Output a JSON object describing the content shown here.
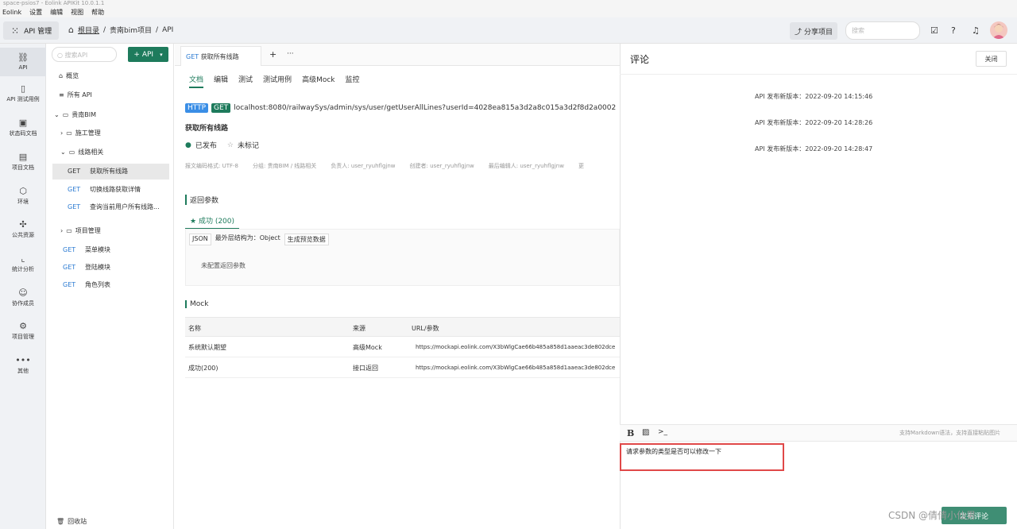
{
  "window": {
    "title": "space-psios7 - Eolink APIKit 10.0.1.1"
  },
  "menu": [
    "Eolink",
    "设置",
    "编辑",
    "视图",
    "帮助"
  ],
  "topbar": {
    "apps_label": "API 管理",
    "breadcrumb": {
      "root": "根目录",
      "project": "贵南bim项目",
      "section": "API"
    },
    "share_label": "分享项目",
    "search_placeholder": "搜索"
  },
  "leftnav": [
    {
      "label": "API",
      "icon": "link-icon"
    },
    {
      "label": "API 测试用例",
      "icon": "clipboard-icon"
    },
    {
      "label": "状态码文档",
      "icon": "code-icon"
    },
    {
      "label": "项目文档",
      "icon": "document-icon"
    },
    {
      "label": "环境",
      "icon": "cube-icon"
    },
    {
      "label": "公共资源",
      "icon": "puzzle-icon"
    },
    {
      "label": "统计分析",
      "icon": "chart-icon"
    },
    {
      "label": "协作成员",
      "icon": "users-icon"
    },
    {
      "label": "项目管理",
      "icon": "settings-icon"
    },
    {
      "label": "其他",
      "icon": "more-icon"
    }
  ],
  "tree": {
    "search_placeholder": "搜索API",
    "add_label": "+ API",
    "overview": "概览",
    "all_api": "所有 API",
    "group": "贵南BIM",
    "folder1": "施工管理",
    "folder2": "线路相关",
    "items": [
      {
        "method": "GET",
        "name": "获取所有线路"
      },
      {
        "method": "GET",
        "name": "切换线路获取详情"
      },
      {
        "method": "GET",
        "name": "查询当前用户所有线路..."
      }
    ],
    "folder3": "项目管理",
    "root_items": [
      {
        "method": "GET",
        "name": "菜单模块"
      },
      {
        "method": "GET",
        "name": "登陆模块"
      },
      {
        "method": "GET",
        "name": "角色列表"
      }
    ],
    "recycle": "回收站"
  },
  "doc_tab": {
    "method": "GET",
    "name": "获取所有线路",
    "add": "+",
    "more": "···"
  },
  "subtabs": [
    "文档",
    "编辑",
    "测试",
    "测试用例",
    "高级Mock",
    "监控"
  ],
  "api": {
    "protocol": "HTTP",
    "method": "GET",
    "url": "localhost:8080/railwaySys/admin/sys/user/getUserAllLines?userId=4028ea815a3d2a8c015a3d2f8d2a0002",
    "name": "获取所有线路",
    "status": "已发布",
    "mark": "未标记",
    "meta": [
      "报文编码格式: UTF-8",
      "分组: 贵南BIM / 线路相关",
      "负责人: user_ryuhflgjnw",
      "创建者: user_ryuhflgjnw",
      "最后编辑人: user_ryuhflgjnw",
      "更"
    ]
  },
  "response": {
    "section": "返回参数",
    "tab": "成功 (200)",
    "format": "JSON",
    "outer": "最外层结构为：Object",
    "gen": "生成预览数据",
    "empty": "未配置返回参数"
  },
  "mock": {
    "section": "Mock",
    "headers": [
      "名称",
      "来源",
      "URL/参数"
    ],
    "rows": [
      [
        "系统默认期望",
        "高级Mock",
        "https://mockapi.eolink.com/X3bWlgCae66b485a858d1aaeac3de802dce"
      ],
      [
        "成功(200)",
        "接口返回",
        "https://mockapi.eolink.com/X3bWlgCae66b485a858d1aaeac3de802dce"
      ]
    ]
  },
  "comments": {
    "title": "评论",
    "close": "关闭",
    "logs": [
      "API 发布新版本：2022-09-20 14:15:46",
      "API 发布新版本：2022-09-20 14:28:26",
      "API 发布新版本：2022-09-20 14:28:47"
    ],
    "hint": "支持Markdown语法，支持直接粘贴图片",
    "input_text": "请求参数的类型是否可以修改一下",
    "watermark": "CSDN @倩倩小仙男",
    "send": "发布评论"
  }
}
